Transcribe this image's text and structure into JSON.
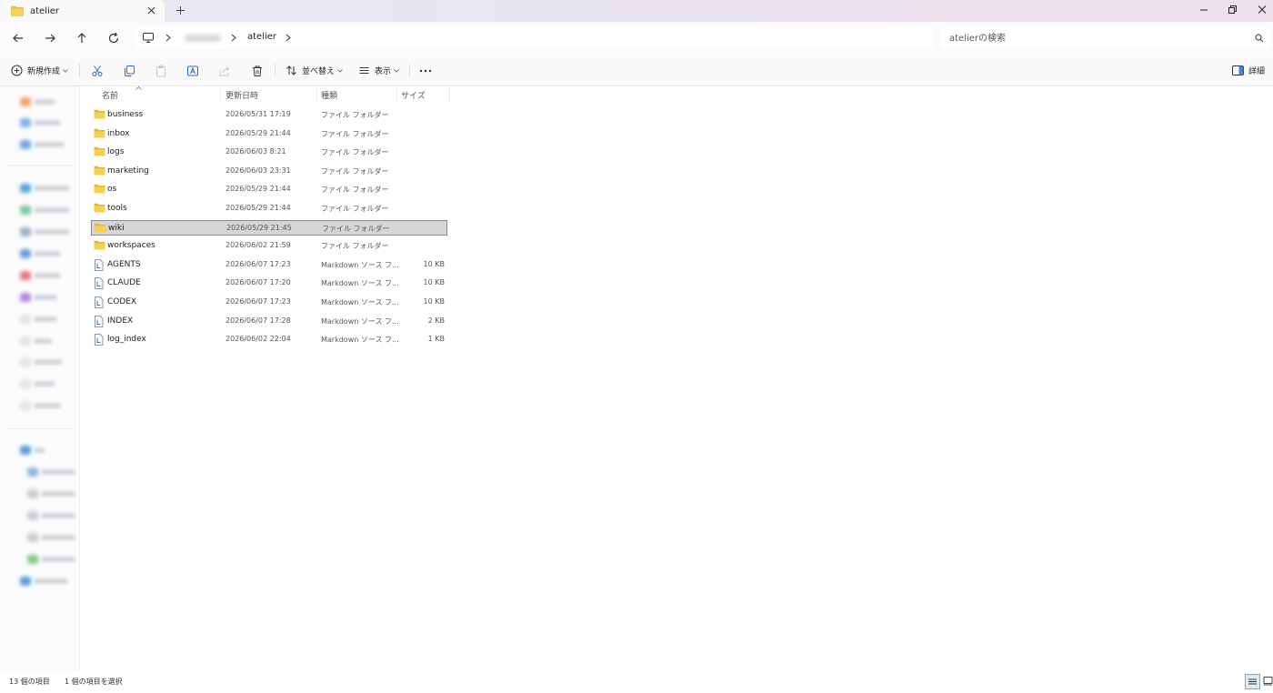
{
  "tab": {
    "title": "atelier",
    "close_label": "×",
    "new_label": "+"
  },
  "address": {
    "path": [
      "atelier"
    ],
    "search_placeholder": "atelierの検索"
  },
  "toolbar": {
    "new_label": "新規作成",
    "sort_label": "並べ替え",
    "view_label": "表示",
    "more_label": "•••",
    "details_label": "詳細"
  },
  "columns": {
    "name": "名前",
    "date": "更新日時",
    "type": "種類",
    "size": "サイズ"
  },
  "files": [
    {
      "name": "business",
      "date": "2026/05/31 17:19",
      "type": "ファイル フォルダー",
      "size": "",
      "icon": "folder-icon"
    },
    {
      "name": "inbox",
      "date": "2026/05/29 21:44",
      "type": "ファイル フォルダー",
      "size": "",
      "icon": "folder-icon"
    },
    {
      "name": "logs",
      "date": "2026/06/03 8:21",
      "type": "ファイル フォルダー",
      "size": "",
      "icon": "folder-icon"
    },
    {
      "name": "marketing",
      "date": "2026/06/03 23:31",
      "type": "ファイル フォルダー",
      "size": "",
      "icon": "folder-icon"
    },
    {
      "name": "os",
      "date": "2026/05/29 21:44",
      "type": "ファイル フォルダー",
      "size": "",
      "icon": "folder-icon"
    },
    {
      "name": "tools",
      "date": "2026/05/29 21:44",
      "type": "ファイル フォルダー",
      "size": "",
      "icon": "folder-icon"
    },
    {
      "name": "wiki",
      "date": "2026/05/29 21:45",
      "type": "ファイル フォルダー",
      "size": "",
      "icon": "folder-icon",
      "selected": true
    },
    {
      "name": "workspaces",
      "date": "2026/06/02 21:59",
      "type": "ファイル フォルダー",
      "size": "",
      "icon": "folder-icon"
    },
    {
      "name": "AGENTS",
      "date": "2026/06/07 17:23",
      "type": "Markdown ソース フ...",
      "size": "10 KB",
      "icon": "markdown-file-icon"
    },
    {
      "name": "CLAUDE",
      "date": "2026/06/07 17:20",
      "type": "Markdown ソース フ...",
      "size": "10 KB",
      "icon": "markdown-file-icon"
    },
    {
      "name": "CODEX",
      "date": "2026/06/07 17:23",
      "type": "Markdown ソース フ...",
      "size": "10 KB",
      "icon": "markdown-file-icon"
    },
    {
      "name": "INDEX",
      "date": "2026/06/07 17:28",
      "type": "Markdown ソース フ...",
      "size": "2 KB",
      "icon": "markdown-file-icon"
    },
    {
      "name": "log_index",
      "date": "2026/06/02 22:04",
      "type": "Markdown ソース フ...",
      "size": "1 KB",
      "icon": "markdown-file-icon"
    }
  ],
  "status": {
    "count": "13 個の項目",
    "selection": "1 個の項目を選択"
  },
  "colors": {
    "folder": "#f3c542",
    "selection_bg": "#d5d5d8",
    "accent": "#2b6cc4"
  }
}
